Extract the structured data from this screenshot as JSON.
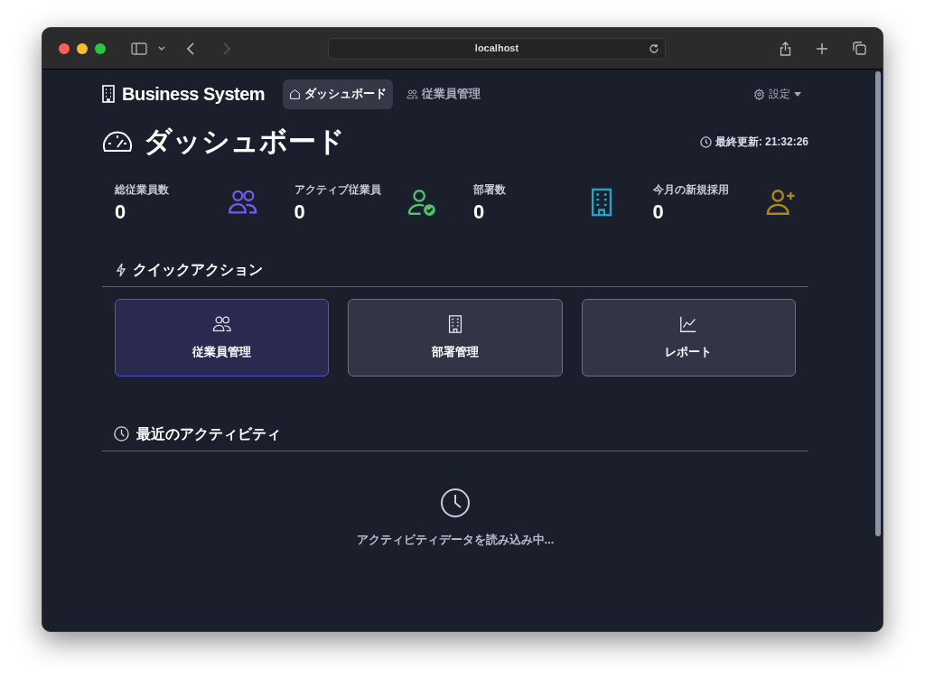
{
  "browser": {
    "url": "localhost"
  },
  "navbar": {
    "brand": "Business System",
    "items": [
      {
        "label": "ダッシュボード",
        "kind": "home",
        "selected": true
      },
      {
        "label": "従業員管理",
        "kind": "users",
        "selected": false
      }
    ],
    "settings": "設定"
  },
  "page": {
    "title": "ダッシュボード",
    "last_updated": "最終更新: 21:32:26"
  },
  "stats": [
    {
      "label": "総従業員数",
      "value": "0",
      "kind": "users",
      "color": "#6d5ff0"
    },
    {
      "label": "アクティブ従業員",
      "value": "0",
      "kind": "user-check",
      "color": "#4fc26b"
    },
    {
      "label": "部署数",
      "value": "0",
      "kind": "building",
      "color": "#1fa9c9"
    },
    {
      "label": "今月の新規採用",
      "value": "0",
      "kind": "user-plus",
      "color": "#b08a12"
    }
  ],
  "quick_actions": {
    "title": "クイックアクション",
    "items": [
      {
        "label": "従業員管理",
        "kind": "users",
        "selected": true
      },
      {
        "label": "部署管理",
        "kind": "building",
        "selected": false
      },
      {
        "label": "レポート",
        "kind": "chart",
        "selected": false
      }
    ]
  },
  "recent": {
    "title": "最近のアクティビティ",
    "message": "アクティビティデータを読み込み中..."
  }
}
